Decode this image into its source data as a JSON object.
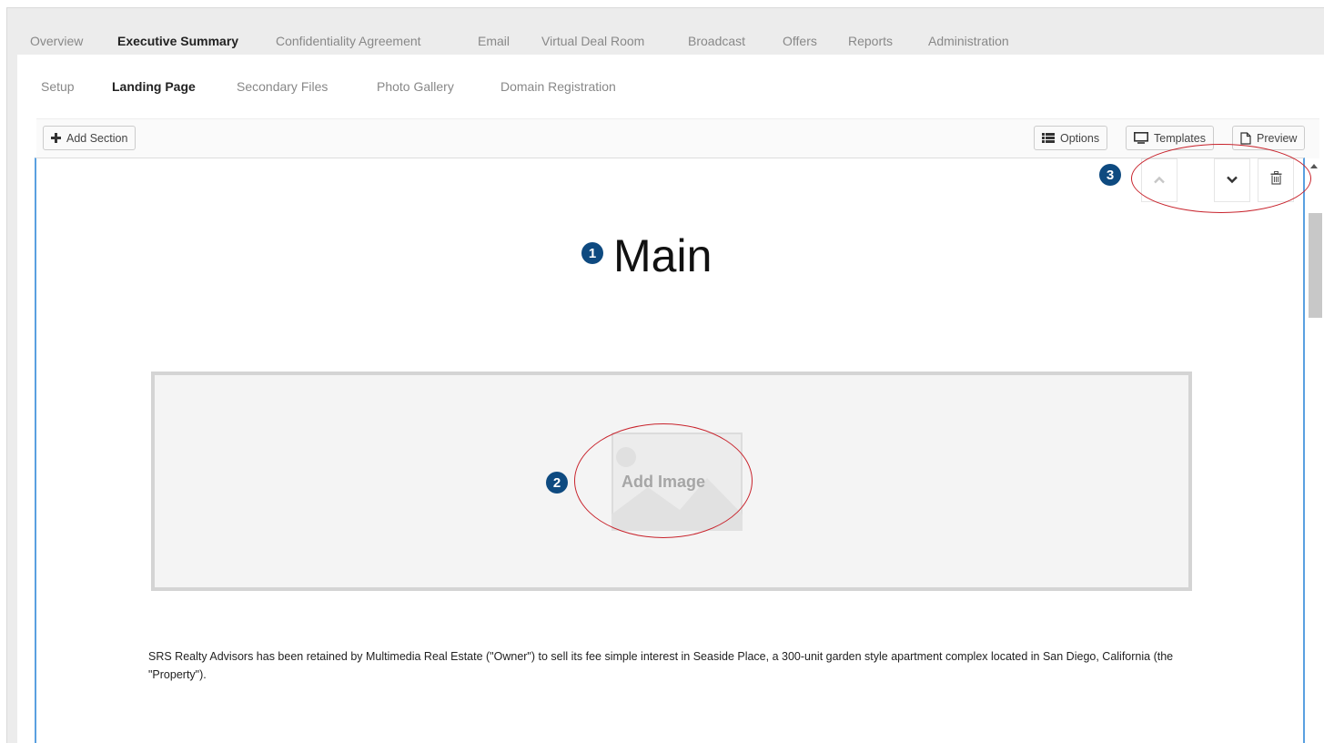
{
  "top_nav": {
    "tabs": [
      {
        "label": "Overview",
        "active": false
      },
      {
        "label": "Executive Summary",
        "active": true
      },
      {
        "label": "Confidentiality Agreement",
        "active": false
      },
      {
        "label": "Email",
        "active": false
      },
      {
        "label": "Virtual Deal Room",
        "active": false
      },
      {
        "label": "Broadcast",
        "active": false
      },
      {
        "label": "Offers",
        "active": false
      },
      {
        "label": "Reports",
        "active": false
      },
      {
        "label": "Administration",
        "active": false
      }
    ]
  },
  "sub_nav": {
    "tabs": [
      {
        "label": "Setup",
        "active": false
      },
      {
        "label": "Landing Page",
        "active": true
      },
      {
        "label": "Secondary Files",
        "active": false
      },
      {
        "label": "Photo Gallery",
        "active": false
      },
      {
        "label": "Domain Registration",
        "active": false
      }
    ]
  },
  "toolbar": {
    "add_section_label": "Add Section",
    "add_section_icon": "plus-icon",
    "options_label": "Options",
    "options_icon": "list-icon",
    "templates_label": "Templates",
    "templates_icon": "monitor-icon",
    "preview_label": "Preview",
    "preview_icon": "document-icon"
  },
  "section_controls": {
    "move_up_icon": "chevron-up-icon",
    "move_down_icon": "chevron-down-icon",
    "delete_icon": "trash-icon"
  },
  "editor": {
    "section_title": "Main",
    "image_placeholder_label": "Add Image",
    "body_text": "SRS Realty Advisors has been retained by Multimedia Real Estate (\"Owner\") to sell its fee simple interest in Seaside Place, a 300-unit garden style apartment complex located in San Diego, California (the \"Property\")."
  },
  "annotations": {
    "badge_1": "1",
    "badge_2": "2",
    "badge_3": "3",
    "badge_color": "#0e4a80",
    "ellipse_color": "#c8232c"
  },
  "colors": {
    "editor_border": "#5aa0e0",
    "background": "#ececec"
  }
}
